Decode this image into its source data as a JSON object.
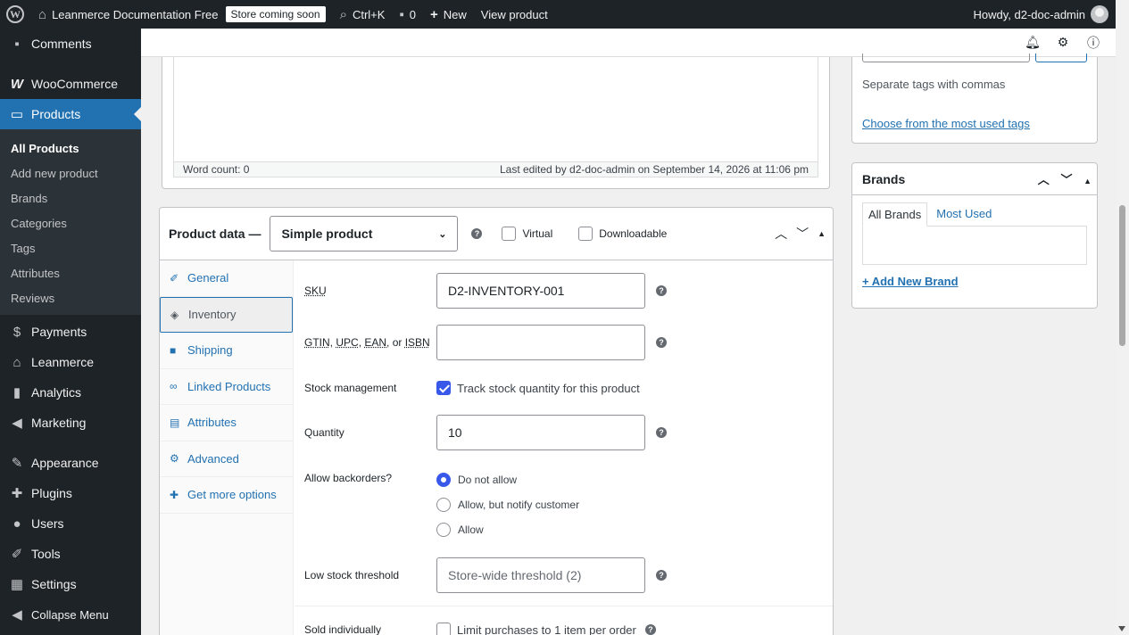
{
  "adminbar": {
    "site_name": "Leanmerce Documentation Free",
    "store_badge": "Store coming soon",
    "search_shortcut": "Ctrl+K",
    "comments_count": "0",
    "new_label": "New",
    "view_product": "View product",
    "howdy": "Howdy, d2-doc-admin"
  },
  "sidebar": {
    "items_top": [
      {
        "label": "Comments",
        "icon": "comment-icon"
      },
      {
        "label": "WooCommerce",
        "icon": "woo-icon"
      },
      {
        "label": "Products",
        "icon": "products-icon"
      }
    ],
    "submenu": [
      {
        "label": "All Products"
      },
      {
        "label": "Add new product"
      },
      {
        "label": "Brands"
      },
      {
        "label": "Categories"
      },
      {
        "label": "Tags"
      },
      {
        "label": "Attributes"
      },
      {
        "label": "Reviews"
      }
    ],
    "items_bottom": [
      {
        "label": "Payments"
      },
      {
        "label": "Leanmerce"
      },
      {
        "label": "Analytics"
      },
      {
        "label": "Marketing"
      },
      {
        "label": "Appearance"
      },
      {
        "label": "Plugins"
      },
      {
        "label": "Users"
      },
      {
        "label": "Tools"
      },
      {
        "label": "Settings"
      },
      {
        "label": "Collapse Menu"
      }
    ]
  },
  "editor": {
    "word_count": "Word count: 0",
    "last_edited": "Last edited by d2-doc-admin on September 14, 2026 at 11:06 pm"
  },
  "product_data": {
    "title": "Product data —",
    "type_value": "Simple product",
    "virtual_label": "Virtual",
    "downloadable_label": "Downloadable",
    "tabs": [
      {
        "label": "General",
        "icon": "wrench-icon"
      },
      {
        "label": "Inventory",
        "icon": "tag-icon"
      },
      {
        "label": "Shipping",
        "icon": "truck-icon"
      },
      {
        "label": "Linked Products",
        "icon": "link-icon"
      },
      {
        "label": "Attributes",
        "icon": "list-icon"
      },
      {
        "label": "Advanced",
        "icon": "gear-icon"
      },
      {
        "label": "Get more options",
        "icon": "plugin-icon"
      }
    ],
    "fields": {
      "sku_label": "SKU",
      "sku_value": "D2-INVENTORY-001",
      "gtin_label_parts": [
        "GTIN",
        ", ",
        "UPC",
        ", ",
        "EAN",
        ", or ",
        "ISBN"
      ],
      "gtin_value": "",
      "stock_mgmt_label": "Stock management",
      "stock_mgmt_check": "Track stock quantity for this product",
      "quantity_label": "Quantity",
      "quantity_value": "10",
      "backorders_label": "Allow backorders?",
      "backorder_options": [
        "Do not allow",
        "Allow, but notify customer",
        "Allow"
      ],
      "low_stock_label": "Low stock threshold",
      "low_stock_placeholder": "Store-wide threshold (2)",
      "sold_individually_label": "Sold individually",
      "sold_individually_check": "Limit purchases to 1 item per order"
    }
  },
  "tags_box": {
    "hint": "Separate tags with commas",
    "most_used_link": "Choose from the most used tags"
  },
  "brands_box": {
    "title": "Brands",
    "tab_all": "All Brands",
    "tab_most_used": "Most Used",
    "add_link": "+ Add New Brand"
  },
  "colors": {
    "admin_dark": "#1d2327",
    "accent": "#2271b1",
    "checkbox": "#3858e9"
  }
}
